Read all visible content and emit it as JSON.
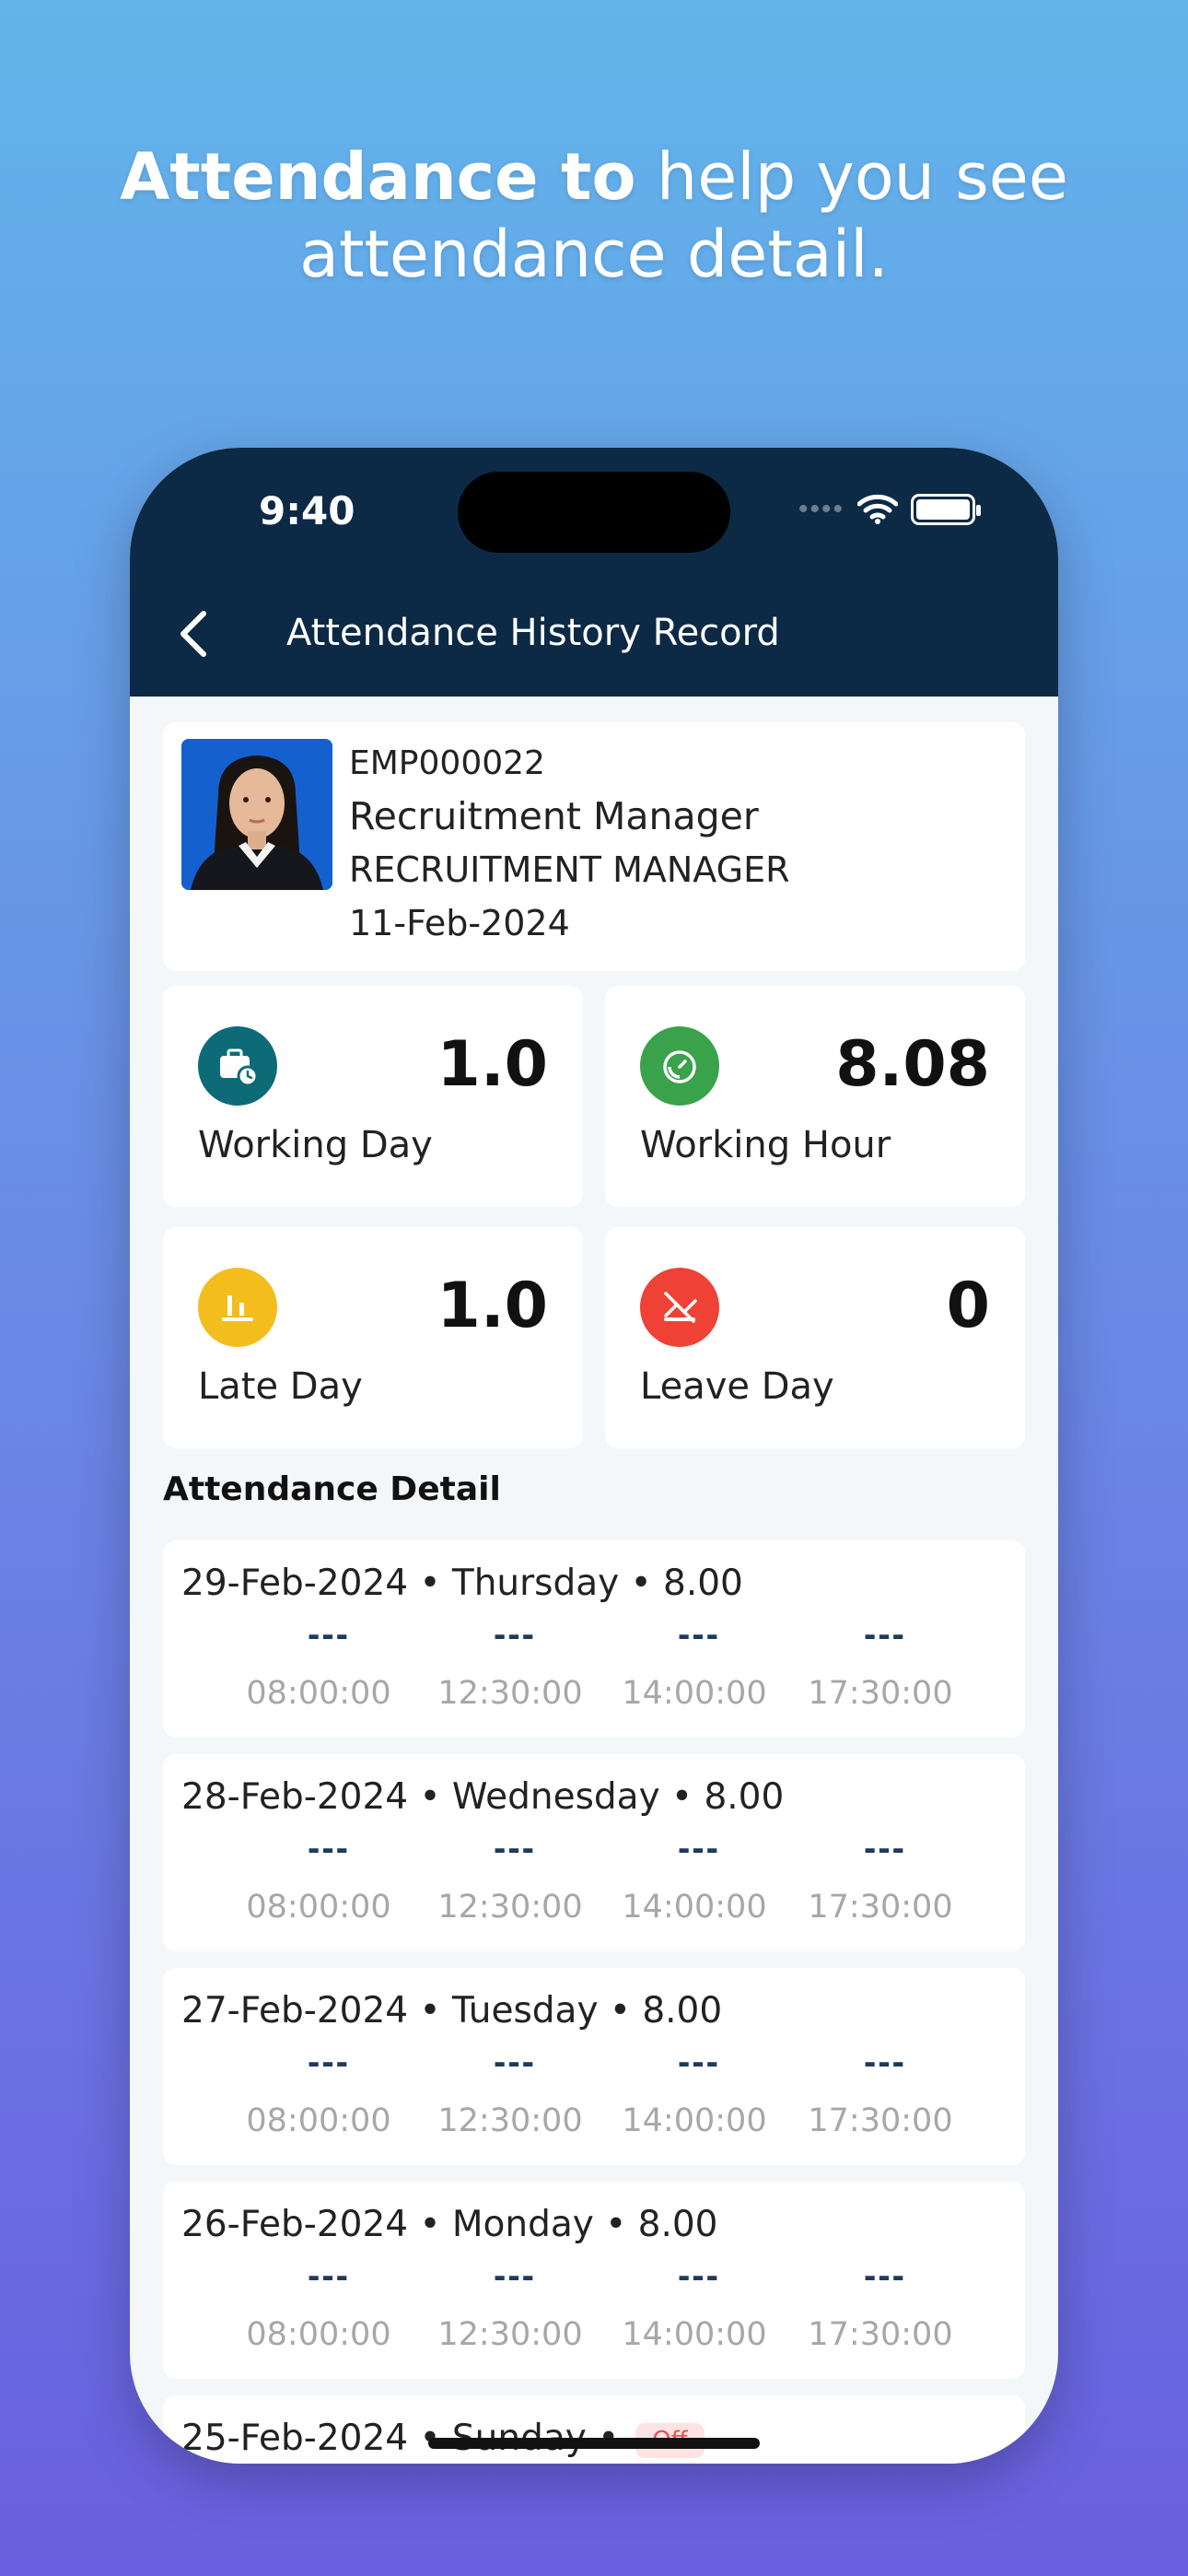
{
  "headline": {
    "bold": "Attendance to",
    "rest": "help you see",
    "line2": "attendance detail."
  },
  "status_bar": {
    "time": "9:40"
  },
  "nav": {
    "title": "Attendance History Record",
    "back_icon": "chevron-left-icon"
  },
  "profile": {
    "emp_id": "EMP000022",
    "position": "Recruitment Manager",
    "department": "RECRUITMENT MANAGER",
    "date": "11-Feb-2024"
  },
  "stats": [
    {
      "label": "Working Day",
      "value": "1.0",
      "icon": "briefcase-clock-icon",
      "color": "#0d6b78"
    },
    {
      "label": "Working Hour",
      "value": "8.08",
      "icon": "timer-icon",
      "color": "#3aa24a"
    },
    {
      "label": "Late Day",
      "value": "1.0",
      "icon": "chart-bars-icon",
      "color": "#f2bd1d"
    },
    {
      "label": "Leave Day",
      "value": "0",
      "icon": "no-clock-icon",
      "color": "#ef4136"
    }
  ],
  "section_title": "Attendance Detail",
  "records": [
    {
      "title": "29-Feb-2024 • Thursday • 8.00",
      "dashes": [
        "---",
        "---",
        "---",
        "---"
      ],
      "times": [
        "08:00:00",
        "12:30:00",
        "14:00:00",
        "17:30:00"
      ]
    },
    {
      "title": "28-Feb-2024 • Wednesday • 8.00",
      "dashes": [
        "---",
        "---",
        "---",
        "---"
      ],
      "times": [
        "08:00:00",
        "12:30:00",
        "14:00:00",
        "17:30:00"
      ]
    },
    {
      "title": "27-Feb-2024 • Tuesday • 8.00",
      "dashes": [
        "---",
        "---",
        "---",
        "---"
      ],
      "times": [
        "08:00:00",
        "12:30:00",
        "14:00:00",
        "17:30:00"
      ]
    },
    {
      "title": "26-Feb-2024 • Monday • 8.00",
      "dashes": [
        "---",
        "---",
        "---",
        "---"
      ],
      "times": [
        "08:00:00",
        "12:30:00",
        "14:00:00",
        "17:30:00"
      ]
    }
  ],
  "partial_record": {
    "title": "25-Feb-2024 • Sunday •",
    "badge": "Off"
  }
}
